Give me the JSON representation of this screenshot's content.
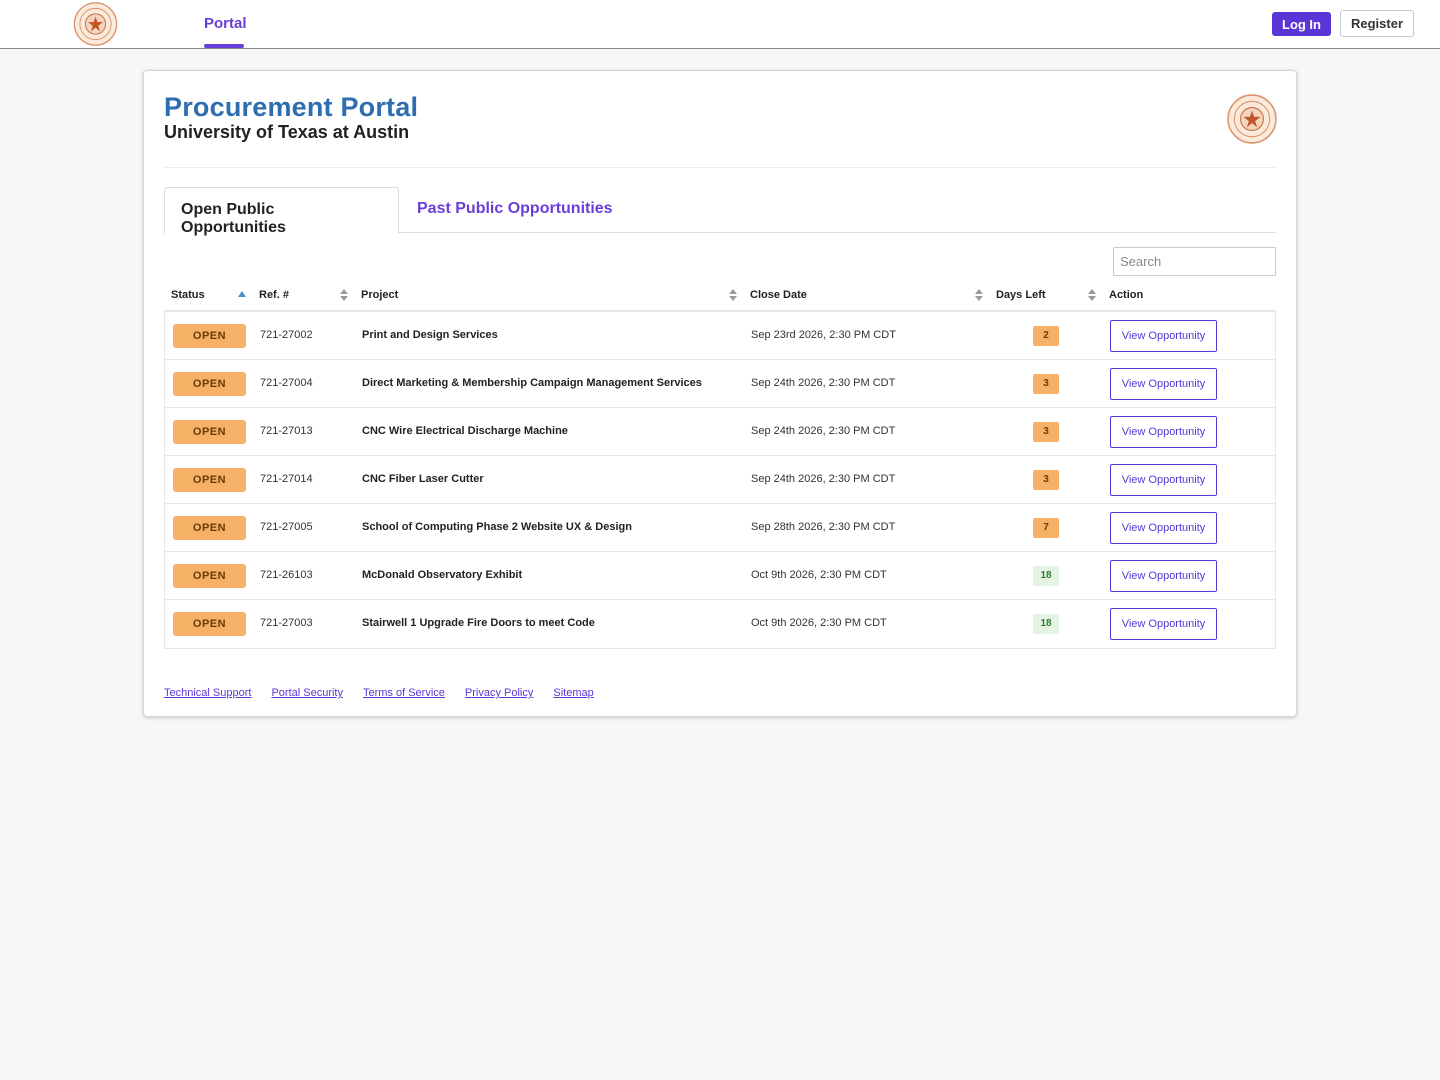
{
  "nav": {
    "tab_portal": "Portal",
    "login_label": "Log In",
    "register_label": "Register"
  },
  "header": {
    "title": "Procurement Portal",
    "subtitle": "University of Texas at Austin"
  },
  "tabs": [
    {
      "label": "Open Public Opportunities",
      "active": true
    },
    {
      "label": "Past Public Opportunities",
      "active": false
    }
  ],
  "search": {
    "placeholder": "Search",
    "value": ""
  },
  "table": {
    "columns": [
      "Status",
      "Ref. #",
      "Project",
      "Close Date",
      "Days Left",
      "Action"
    ],
    "rows": [
      {
        "status": "OPEN",
        "ref": "721-27002",
        "project": "Print and Design Services",
        "close_date": "Sep 23rd 2026, 2:30 PM CDT",
        "days_left": "2",
        "action": "View Opportunity"
      },
      {
        "status": "OPEN",
        "ref": "721-27004",
        "project": "Direct Marketing & Membership Campaign Management Services",
        "close_date": "Sep 24th 2026, 2:30 PM CDT",
        "days_left": "3",
        "action": "View Opportunity"
      },
      {
        "status": "OPEN",
        "ref": "721-27013",
        "project": "CNC Wire Electrical Discharge Machine",
        "close_date": "Sep 24th 2026, 2:30 PM CDT",
        "days_left": "3",
        "action": "View Opportunity"
      },
      {
        "status": "OPEN",
        "ref": "721-27014",
        "project": "CNC Fiber Laser Cutter",
        "close_date": "Sep 24th 2026, 2:30 PM CDT",
        "days_left": "3",
        "action": "View Opportunity"
      },
      {
        "status": "OPEN",
        "ref": "721-27005",
        "project": "School of Computing Phase 2 Website UX & Design",
        "close_date": "Sep 28th 2026, 2:30 PM CDT",
        "days_left": "7",
        "action": "View Opportunity"
      },
      {
        "status": "OPEN",
        "ref": "721-26103",
        "project": "McDonald Observatory Exhibit",
        "close_date": "Oct 9th 2026, 2:30 PM CDT",
        "days_left": "18",
        "action": "View Opportunity"
      },
      {
        "status": "OPEN",
        "ref": "721-27003",
        "project": "Stairwell 1 Upgrade Fire Doors to meet Code",
        "close_date": "Oct 9th 2026, 2:30 PM CDT",
        "days_left": "18",
        "action": "View Opportunity"
      }
    ]
  },
  "footer": {
    "links": [
      "Technical Support",
      "Portal Security",
      "Terms of Service",
      "Privacy Policy",
      "Sitemap"
    ]
  },
  "colors": {
    "accent": "#5b36d6",
    "title_blue": "#2d6db0",
    "open_badge": "#f5b267",
    "days_urgent": "#f5b267",
    "days_ok": "#e4f3e4",
    "days_ok_text": "#2e7d32"
  },
  "icons": {
    "logo": "university-seal-icon",
    "sort_asc": "sort-ascending-icon",
    "sort_both": "sort-both-icon"
  }
}
